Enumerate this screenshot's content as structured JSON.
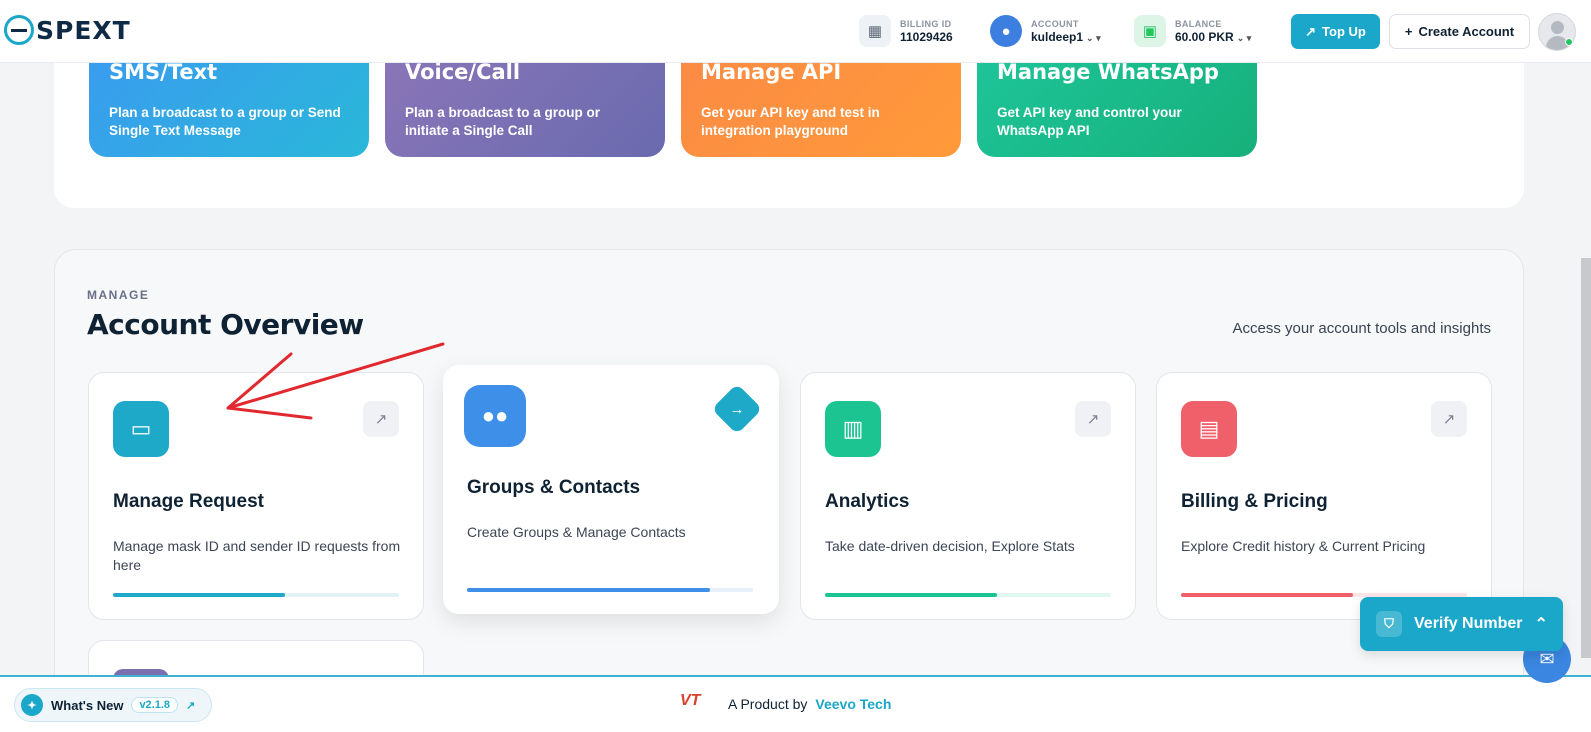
{
  "header": {
    "logo": "SPEXT",
    "billing": {
      "label": "BILLING ID",
      "value": "11029426"
    },
    "account": {
      "label": "ACCOUNT",
      "value": "kuldeep1"
    },
    "balance": {
      "label": "BALANCE",
      "value": "60.00 PKR"
    },
    "topup_label": "Top Up",
    "create_label": "Create Account"
  },
  "services": [
    {
      "title": "SMS/Text",
      "desc": "Plan a broadcast to a group or Send Single Text Message",
      "color": "#2fa8e6"
    },
    {
      "title": "Voice/Call",
      "desc": "Plan a broadcast to a group or initiate a Single Call",
      "color": "#7c6fb0"
    },
    {
      "title": "Manage API",
      "desc": "Get your API key and test in integration playground",
      "color": "#fb8a3c"
    },
    {
      "title": "Manage WhatsApp",
      "desc": "Get API key and control your WhatsApp API",
      "color": "#1ec08a"
    }
  ],
  "manage": {
    "eyebrow": "MANAGE",
    "title": "Account Overview",
    "subtitle": "Access your account tools and insights",
    "cards": [
      {
        "title": "Manage Request",
        "desc": "Manage mask ID and sender ID requests from here",
        "icon": "monitor-icon",
        "color": "#1fa9c9",
        "progress": 0.6
      },
      {
        "title": "Groups & Contacts",
        "desc": "Create Groups & Manage Contacts",
        "icon": "users-icon",
        "color": "#3d8fe8",
        "progress": 0.85
      },
      {
        "title": "Analytics",
        "desc": "Take date-driven decision, Explore Stats",
        "icon": "chart-icon",
        "color": "#1cc491",
        "progress": 0.6
      },
      {
        "title": "Billing & Pricing",
        "desc": "Explore Credit history & Current Pricing",
        "icon": "receipt-icon",
        "color": "#f0606a",
        "progress": 0.6
      }
    ]
  },
  "footer": {
    "whats_new": "What's New",
    "version": "v2.1.8",
    "product_prefix": "A Product by",
    "brand": "Veevo Tech"
  },
  "verify_label": "Verify Number"
}
